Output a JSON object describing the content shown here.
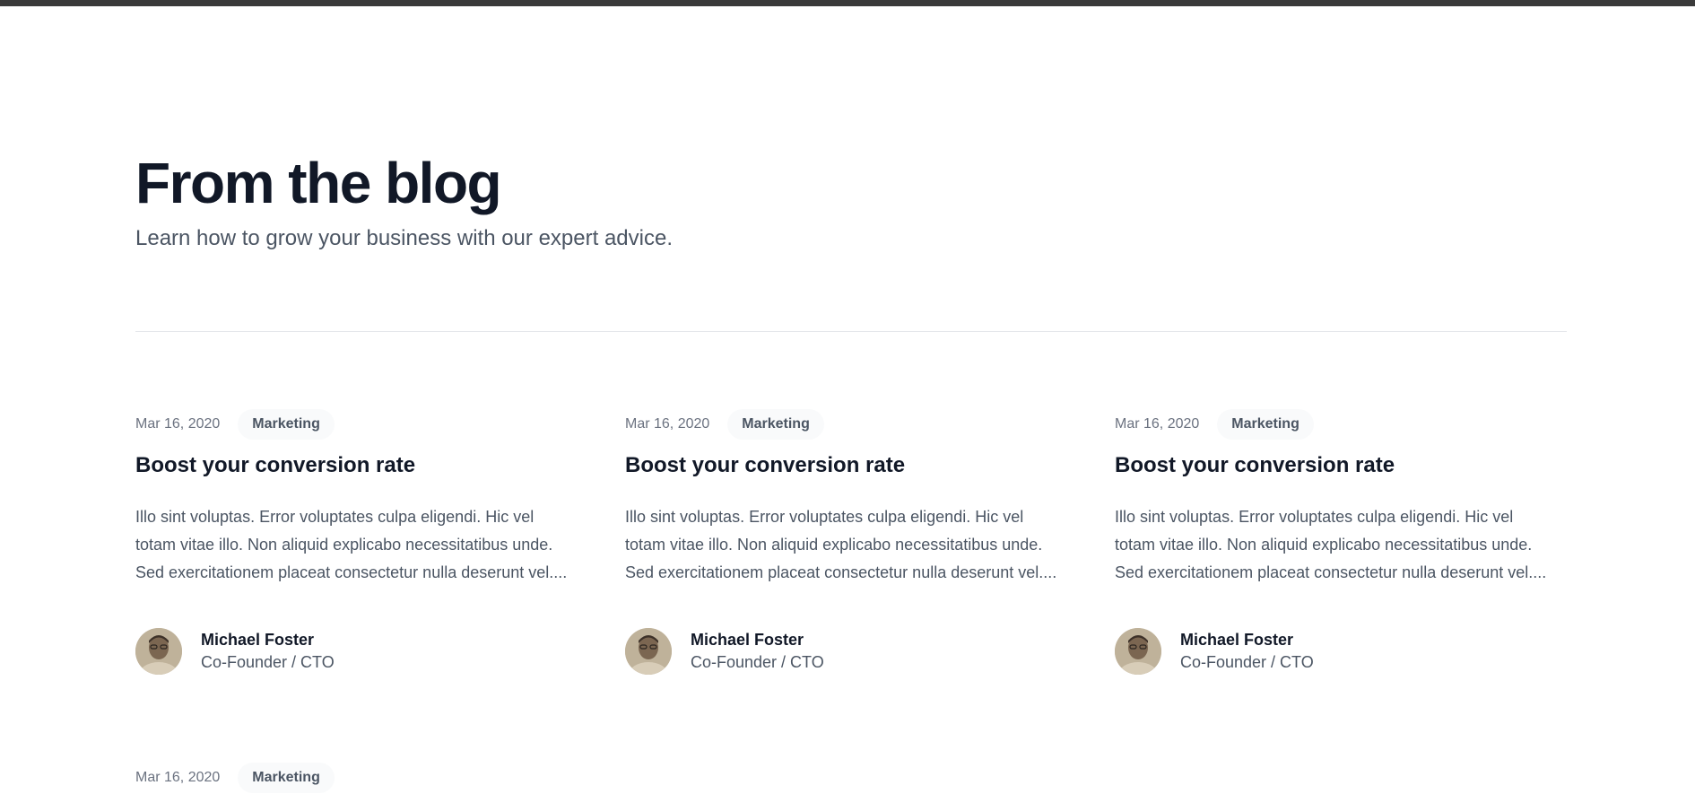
{
  "header": {
    "title": "From the blog",
    "subtitle": "Learn how to grow your business with our expert advice."
  },
  "posts": [
    {
      "date": "Mar 16, 2020",
      "category": "Marketing",
      "title": "Boost your conversion rate",
      "excerpt": "Illo sint voluptas. Error voluptates culpa eligendi. Hic vel totam vitae illo. Non aliquid explicabo necessitatibus unde. Sed exercitationem placeat consectetur nulla deserunt vel....",
      "author": {
        "name": "Michael Foster",
        "role": "Co-Founder / CTO"
      }
    },
    {
      "date": "Mar 16, 2020",
      "category": "Marketing",
      "title": "Boost your conversion rate",
      "excerpt": "Illo sint voluptas. Error voluptates culpa eligendi. Hic vel totam vitae illo. Non aliquid explicabo necessitatibus unde. Sed exercitationem placeat consectetur nulla deserunt vel....",
      "author": {
        "name": "Michael Foster",
        "role": "Co-Founder / CTO"
      }
    },
    {
      "date": "Mar 16, 2020",
      "category": "Marketing",
      "title": "Boost your conversion rate",
      "excerpt": "Illo sint voluptas. Error voluptates culpa eligendi. Hic vel totam vitae illo. Non aliquid explicabo necessitatibus unde. Sed exercitationem placeat consectetur nulla deserunt vel....",
      "author": {
        "name": "Michael Foster",
        "role": "Co-Founder / CTO"
      }
    },
    {
      "date": "Mar 16, 2020",
      "category": "Marketing"
    }
  ],
  "colors": {
    "heading": "#111827",
    "body": "#4b5563",
    "muted": "#6b7280",
    "tag_bg": "#f9fafb",
    "divider": "#e5e7eb",
    "topbar": "#3a3a3a"
  }
}
